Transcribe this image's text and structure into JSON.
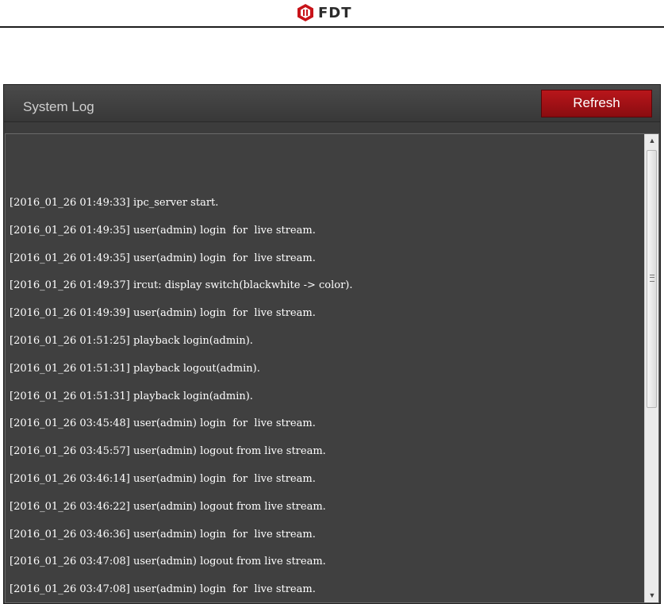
{
  "brand": {
    "logo_text": "FDT"
  },
  "panel": {
    "title": "System Log",
    "refresh_label": "Refresh"
  },
  "log": {
    "lines": [
      "[2016_01_26 01:49:33] ipc_server start.",
      "[2016_01_26 01:49:35] user(admin) login  for  live stream.",
      "[2016_01_26 01:49:35] user(admin) login  for  live stream.",
      "[2016_01_26 01:49:37] ircut: display switch(blackwhite -> color).",
      "[2016_01_26 01:49:39] user(admin) login  for  live stream.",
      "[2016_01_26 01:51:25] playback login(admin).",
      "[2016_01_26 01:51:31] playback logout(admin).",
      "[2016_01_26 01:51:31] playback login(admin).",
      "[2016_01_26 03:45:48] user(admin) login  for  live stream.",
      "[2016_01_26 03:45:57] user(admin) logout from live stream.",
      "[2016_01_26 03:46:14] user(admin) login  for  live stream.",
      "[2016_01_26 03:46:22] user(admin) logout from live stream.",
      "[2016_01_26 03:46:36] user(admin) login  for  live stream.",
      "[2016_01_26 03:47:08] user(admin) logout from live stream.",
      "[2016_01_26 03:47:08] user(admin) login  for  live stream."
    ]
  },
  "colors": {
    "accent": "#b8161b",
    "panel_bg": "#3c3c3c"
  }
}
